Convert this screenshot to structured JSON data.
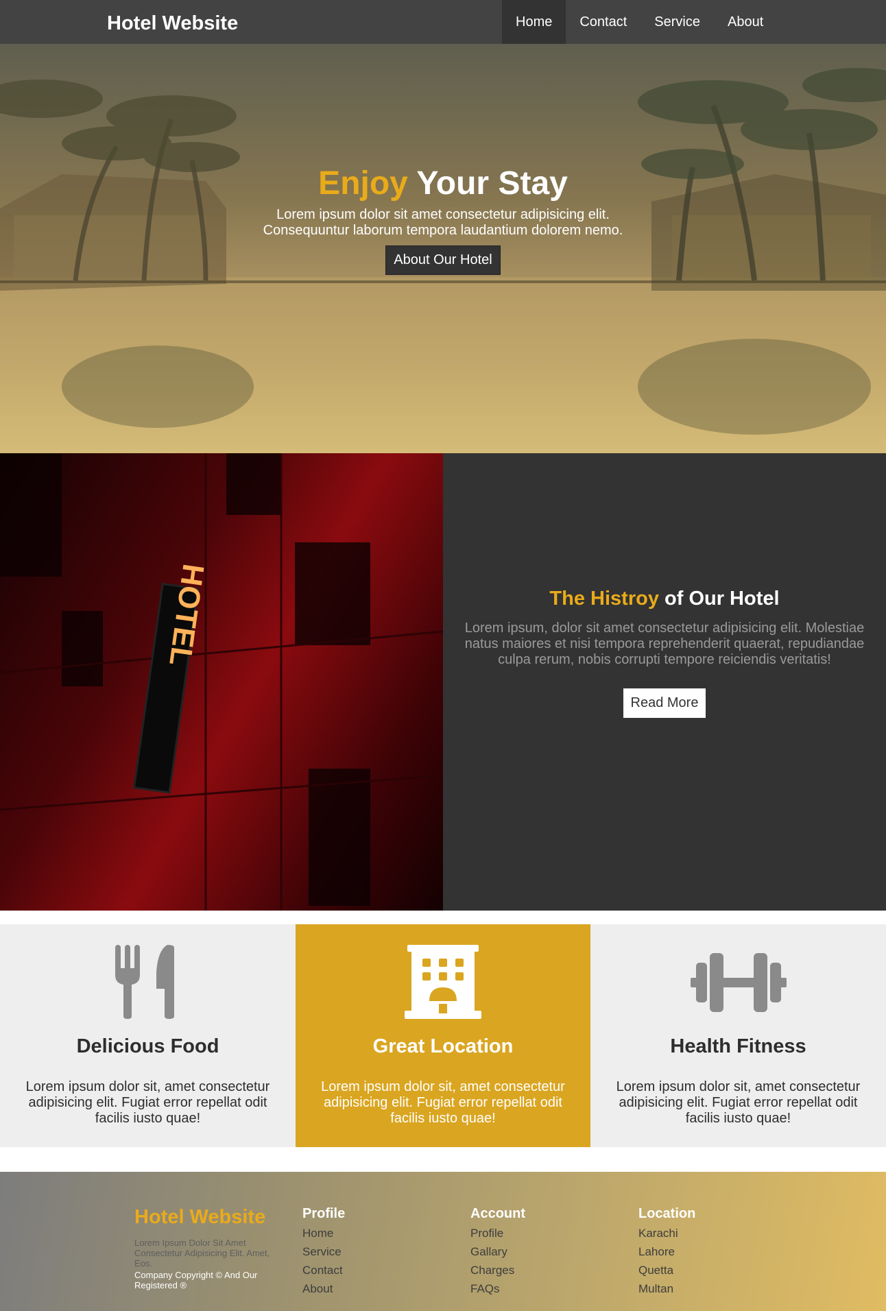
{
  "navbar": {
    "brand": "Hotel Website",
    "links": [
      {
        "label": "Home",
        "active": true
      },
      {
        "label": "Contact",
        "active": false
      },
      {
        "label": "Service",
        "active": false
      },
      {
        "label": "About",
        "active": false
      }
    ]
  },
  "hero": {
    "title_accent": "Enjoy",
    "title_rest": " Your Stay",
    "subtitle_line1": "Lorem ipsum dolor sit amet consectetur adipisicing elit.",
    "subtitle_line2": "Consequuntur laborum tempora laudantium dolorem nemo.",
    "button": "About Our Hotel"
  },
  "history": {
    "sign_text": "HOTEL",
    "title_accent": "The Histroy",
    "title_rest": " of Our Hotel",
    "text": "Lorem ipsum, dolor sit amet consectetur adipisicing elit. Molestiae natus maiores et nisi tempora reprehenderit quaerat, repudiandae culpa rerum, nobis corrupti tempore reiciendis veritatis!",
    "button": "Read More"
  },
  "features": [
    {
      "icon": "utensils-icon",
      "title": "Delicious Food",
      "text": "Lorem ipsum dolor sit, amet consectetur adipisicing elit. Fugiat error repellat odit facilis iusto quae!"
    },
    {
      "icon": "building-icon",
      "title": "Great Location",
      "text": "Lorem ipsum dolor sit, amet consectetur adipisicing elit. Fugiat error repellat odit facilis iusto quae!"
    },
    {
      "icon": "dumbbell-icon",
      "title": "Health Fitness",
      "text": "Lorem ipsum dolor sit, amet consectetur adipisicing elit. Fugiat error repellat odit facilis iusto quae!"
    }
  ],
  "footer": {
    "brand": "Hotel Website",
    "desc": "Lorem Ipsum Dolor Sit Amet Consectetur Adipisicing Elit. Amet, Eos.",
    "copyright": "Company Copyright © And Our Registered ®",
    "columns": [
      {
        "title": "Profile",
        "links": [
          "Home",
          "Service",
          "Contact",
          "About"
        ]
      },
      {
        "title": "Account",
        "links": [
          "Profile",
          "Gallary",
          "Charges",
          "FAQs"
        ]
      },
      {
        "title": "Location",
        "links": [
          "Karachi",
          "Lahore",
          "Quetta",
          "Multan"
        ]
      }
    ]
  },
  "colors": {
    "accent": "#eaab1a",
    "highlight_card": "#daa520",
    "dark": "#333333",
    "navbar": "#434343"
  }
}
